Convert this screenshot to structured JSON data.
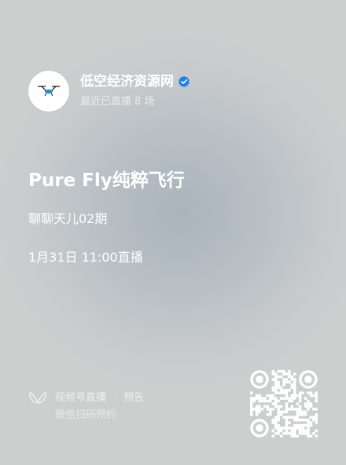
{
  "header": {
    "account_name": "低空经济资源网",
    "status": "最近已直播 8 场",
    "verified_icon": "verified-badge-icon",
    "verified_color": "#1e7ff2"
  },
  "live": {
    "title": "Pure Fly纯粹飞行",
    "subtitle": "聊聊天儿02期",
    "time": "1月31日 11:00直播"
  },
  "footer": {
    "brand": "视频号直播",
    "separator": "·",
    "type": "预告",
    "hint": "微信扫码预约",
    "brand_icon": "channels-butterfly-icon",
    "qr_icon": "qr-code-icon"
  }
}
